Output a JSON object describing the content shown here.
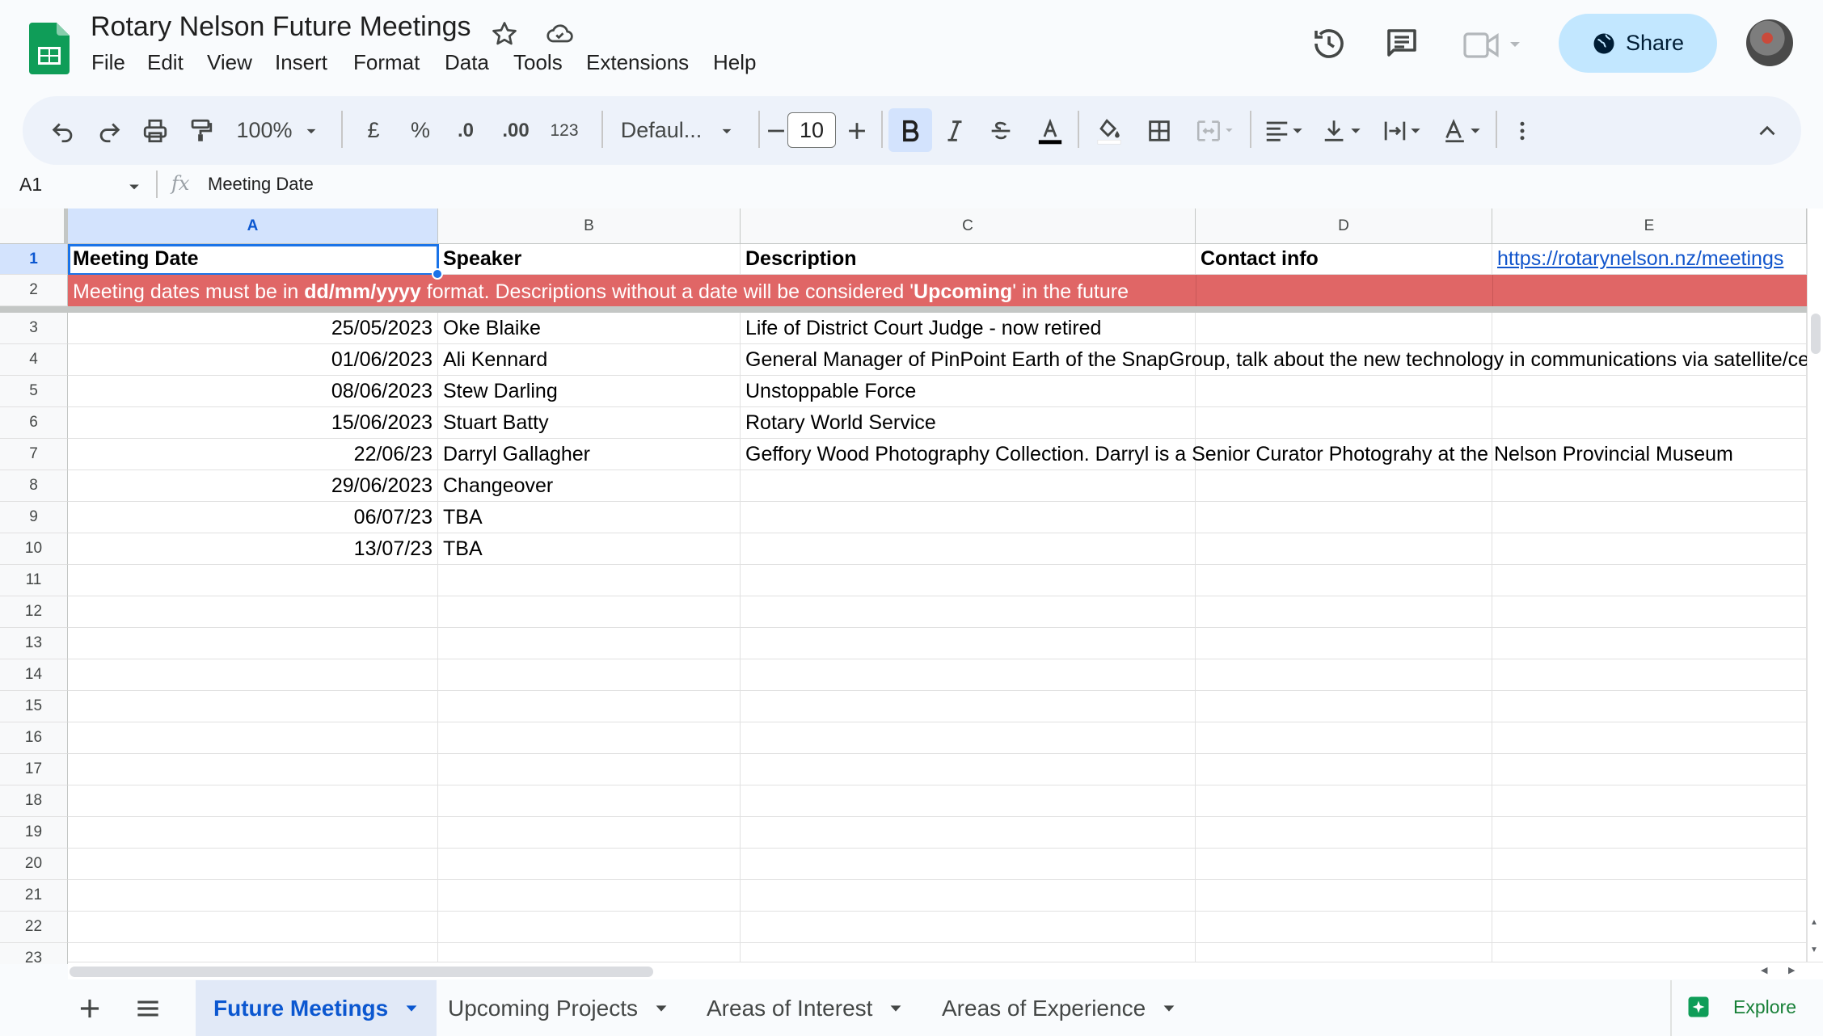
{
  "doc": {
    "title": "Rotary Nelson Future Meetings"
  },
  "menu": [
    "File",
    "Edit",
    "View",
    "Insert",
    "Format",
    "Data",
    "Tools",
    "Extensions",
    "Help"
  ],
  "header": {
    "share_label": "Share"
  },
  "toolbar": {
    "zoom": "100%",
    "currency": "£",
    "percent": "%",
    "decrease_decimals": ".0",
    "increase_decimals": ".00",
    "number_format": "123",
    "font": "Defaul...",
    "font_size": "10"
  },
  "formula_bar": {
    "cell_ref": "A1",
    "fx": "fx",
    "content": "Meeting Date"
  },
  "columns": [
    "A",
    "B",
    "C",
    "D",
    "E"
  ],
  "header_row": {
    "a": "Meeting Date",
    "b": "Speaker",
    "c": "Description",
    "d": "Contact info",
    "e": "https://rotarynelson.nz/meetings"
  },
  "notice": {
    "p1": "Meeting dates must be in ",
    "b1": "dd/mm/yyyy",
    "p2": " format. Descriptions without a date will be considered '",
    "b2": "Upcoming",
    "p3": "' in the future",
    "color": "#e06666"
  },
  "rows": [
    {
      "n": "3",
      "date": "25/05/2023",
      "speaker": "Oke Blaike",
      "desc": "Life of District Court Judge - now retired"
    },
    {
      "n": "4",
      "date": "01/06/2023",
      "speaker": "Ali Kennard",
      "desc": "General Manager of PinPoint Earth of the SnapGroup, talk about the new technology in communications via satellite/cellu"
    },
    {
      "n": "5",
      "date": "08/06/2023",
      "speaker": "Stew Darling",
      "desc": "Unstoppable Force"
    },
    {
      "n": "6",
      "date": "15/06/2023",
      "speaker": "Stuart Batty",
      "desc": "Rotary World Service"
    },
    {
      "n": "7",
      "date": "22/06/23",
      "speaker": "Darryl Gallagher",
      "desc": "Geffory Wood Photography Collection. Darryl is a Senior Curator Photograhy at the Nelson Provincial Museum"
    },
    {
      "n": "8",
      "date": "29/06/2023",
      "speaker": "Changeover",
      "desc": ""
    },
    {
      "n": "9",
      "date": "06/07/23",
      "speaker": "TBA",
      "desc": ""
    },
    {
      "n": "10",
      "date": "13/07/23",
      "speaker": "TBA",
      "desc": ""
    }
  ],
  "row_numbers": [
    "1",
    "2",
    "3",
    "4",
    "5",
    "6",
    "7",
    "8",
    "9",
    "10",
    "11",
    "12",
    "13",
    "14",
    "15",
    "16",
    "17",
    "18",
    "19",
    "20",
    "21",
    "22",
    "23"
  ],
  "sheet_tabs": [
    "Future Meetings",
    "Upcoming Projects",
    "Areas of Interest",
    "Areas of Experience"
  ],
  "explore_label": "Explore"
}
